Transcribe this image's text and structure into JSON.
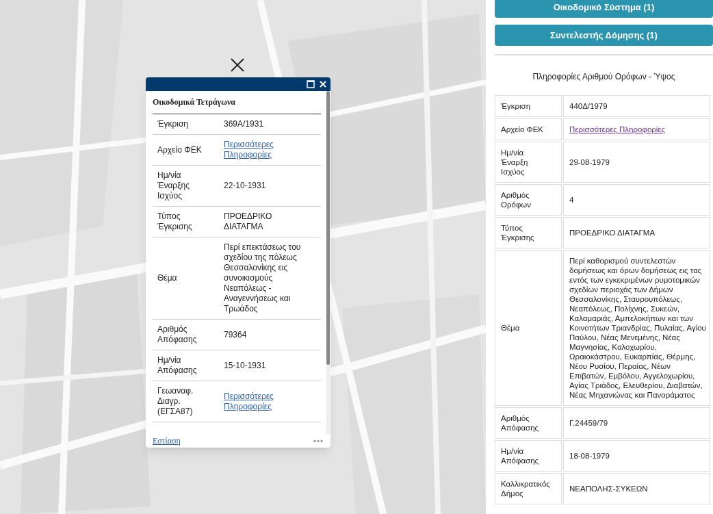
{
  "popup": {
    "title": "Οικοδομικά Τετράγωνα",
    "rows": [
      {
        "label": "Έγκριση",
        "kind": "text",
        "value": "369Α/1931"
      },
      {
        "label": "Αρχείο ΦΕΚ",
        "kind": "link",
        "value": "Περισσότερες Πληροφορίες"
      },
      {
        "label": "Ημ/νία Έναρξης Ισχύος",
        "kind": "text",
        "value": "22-10-1931"
      },
      {
        "label": "Τύπος Έγκρισης",
        "kind": "text",
        "value": "ΠΡΟΕΔΡΙΚΟ ΔΙΑΤΑΓΜΑ"
      },
      {
        "label": "Θέμα",
        "kind": "text",
        "value": "Περί επεκτάσεως του σχεδίου της πόλεως Θεσσαλονίκης εις συνοικισμούς Νεαπόλεως - Αναγεννήσεως και Τρωάδος"
      },
      {
        "label": "Αριθμός Απόφασης",
        "kind": "text",
        "value": "79364"
      },
      {
        "label": "Ημ/νία Απόφασης",
        "kind": "text",
        "value": "15-10-1931"
      },
      {
        "label": "Γεωαναφ. Διαγρ. (ΕΓΣΑ87)",
        "kind": "link",
        "value": "Περισσότερες Πληροφορίες"
      }
    ],
    "footer_link": "Εστίαση"
  },
  "panel": {
    "buttons": [
      "Οικοδομικό Σύστημα (1)",
      "Συντελεστής Δόμησης (1)"
    ],
    "caption": "Πληροφορίες Αριθμού Ορόφων - Ύψος",
    "rows": [
      {
        "label": "Έγκριση",
        "kind": "text",
        "value": "440Δ/1979"
      },
      {
        "label": "Αρχείο ΦΕΚ",
        "kind": "link",
        "value": "Περισσότερες Πληροφορίες"
      },
      {
        "label": "Ημ/νία Έναρξη Ισχύος",
        "kind": "text",
        "value": "29-08-1979"
      },
      {
        "label": "Αριθμός Ορόφων",
        "kind": "text",
        "value": "4"
      },
      {
        "label": "Τύπος Έγκρισης",
        "kind": "text",
        "value": "ΠΡΟΕΔΡΙΚΟ ΔΙΑΤΑΓΜΑ"
      },
      {
        "label": "Θέμα",
        "kind": "text",
        "value": "Περί καθορισμού συντελεστών δομήσεως και όρων δομήσεως εις τας εντός των εγκεκριμένων ρυμοτομικών σχεδίων περιοχάς των Δήμων Θεσσαλονίκης, Σταυρουπόλεως, Νεαπόλεως, Πολίχνης, Συκεών, Καλαμαριάς, Αμπελοκήπων και των Κοινοτήτων Τριανδρίας, Πυλαίας, Αγίου Παύλου, Νέας Μενεμένης, Νέας Μαγνησίας, Καλοχωρίου, Ωραιοκάστρου, Ευκαρπίας, Θέρμης, Νέου Ρυσίου, Περαίας, Νέων Επιβατών, Εμβόλου, Αγγελοχωρίου, Αγίας Τριάδος, Ελευθερίου, Διαβατών, Νέας Μηχανιώνας και Πανοράματος"
      },
      {
        "label": "Αριθμός Απόφασης",
        "kind": "text",
        "value": "Γ.24459/79"
      },
      {
        "label": "Ημ/νία Απόφασης",
        "kind": "text",
        "value": "18-08-1979"
      },
      {
        "label": "Καλλικρατικός Δήμος",
        "kind": "text",
        "value": "ΝΕΑΠΟΛΗΣ-ΣΥΚΕΩΝ"
      }
    ]
  }
}
